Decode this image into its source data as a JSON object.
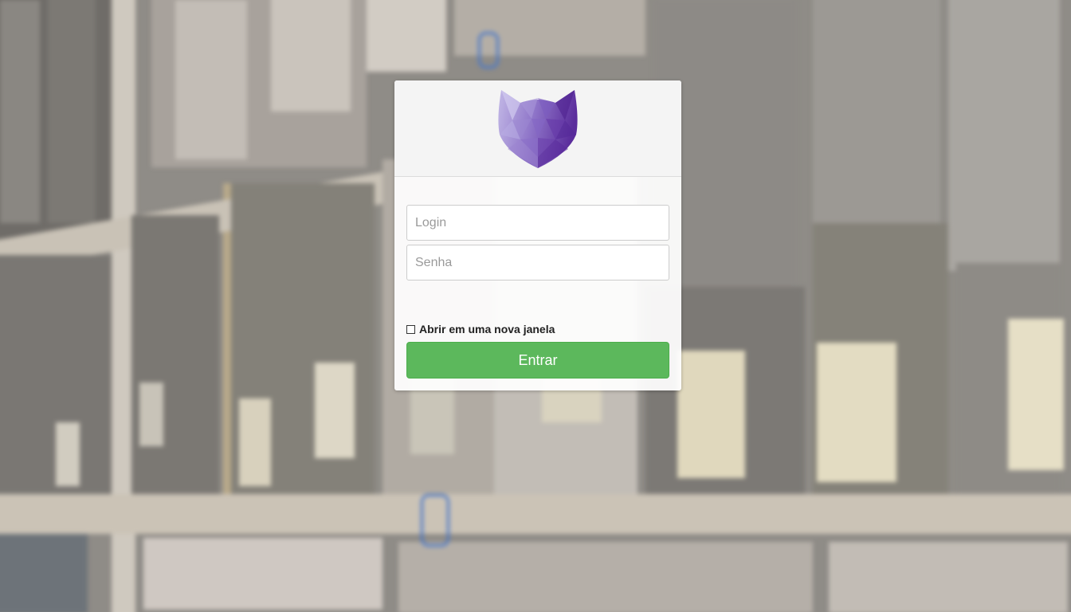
{
  "login_form": {
    "login_placeholder": "Login",
    "password_placeholder": "Senha",
    "login_value": "",
    "password_value": "",
    "new_window_label": "Abrir em uma nova janela",
    "new_window_checked": false,
    "submit_label": "Entrar"
  },
  "icons": {
    "logo": "fox-head-logo-icon"
  },
  "colors": {
    "submit_button": "#5cb85c",
    "logo_light": "#b9aee0",
    "logo_dark": "#5b2d9c",
    "header_background": "#f4f4f4"
  }
}
